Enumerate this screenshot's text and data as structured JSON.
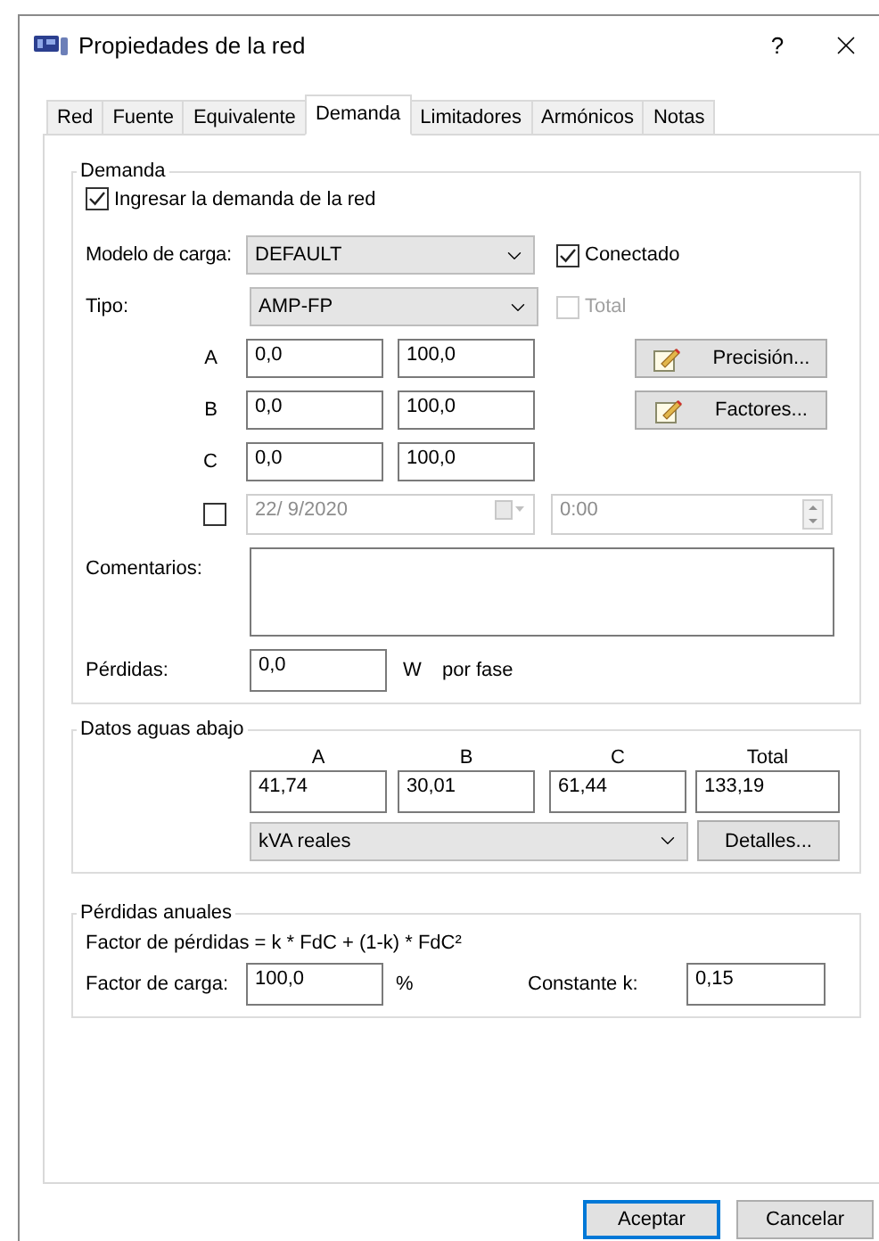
{
  "window": {
    "title": "Propiedades de la red",
    "help": "?"
  },
  "tabs": [
    {
      "label": "Red",
      "selected": false
    },
    {
      "label": "Fuente",
      "selected": false
    },
    {
      "label": "Equivalente",
      "selected": false
    },
    {
      "label": "Demanda",
      "selected": true
    },
    {
      "label": "Limitadores",
      "selected": false
    },
    {
      "label": "Armónicos",
      "selected": false
    },
    {
      "label": "Notas",
      "selected": false
    }
  ],
  "demanda": {
    "title": "Demanda",
    "enter_demand": {
      "label": "Ingresar la demanda de la red",
      "checked": true
    },
    "load_model": {
      "label": "Modelo de carga:",
      "value": "DEFAULT"
    },
    "connected": {
      "label": "Conectado",
      "checked": true,
      "disabled": false
    },
    "type": {
      "label": "Tipo:",
      "value": "AMP-FP"
    },
    "total": {
      "label": "Total",
      "checked": false,
      "disabled": true
    },
    "phases": [
      {
        "label": "A",
        "value_1": "0,0",
        "value_2": "100,0"
      },
      {
        "label": "B",
        "value_1": "0,0",
        "value_2": "100,0"
      },
      {
        "label": "C",
        "value_1": "0,0",
        "value_2": "100,0"
      }
    ],
    "side_buttons": [
      "Precisión...",
      "Factores..."
    ],
    "date_enabled": {
      "checked": false
    },
    "date": {
      "value": "22/ 9/2020",
      "disabled": true
    },
    "time": {
      "value": "0:00",
      "disabled": true
    },
    "comments": {
      "label": "Comentarios:"
    },
    "losses": {
      "label": "Pérdidas:",
      "value": "0,0",
      "unit": "W",
      "suffix": "por fase"
    }
  },
  "downstream": {
    "title": "Datos aguas abajo",
    "columns": [
      {
        "header": "A",
        "value": "41,74"
      },
      {
        "header": "B",
        "value": "30,01"
      },
      {
        "header": "C",
        "value": "61,44"
      },
      {
        "header": "Total",
        "value": "133,19"
      }
    ],
    "unit_select": "kVA reales",
    "details_button": "Detalles..."
  },
  "annual_losses": {
    "title": "Pérdidas anuales",
    "formula": "Factor de pérdidas = k * FdC + (1-k) * FdC²",
    "load_factor": {
      "label": "Factor de carga:",
      "value": "100,0",
      "unit": "%"
    },
    "constant_k": {
      "label": "Constante k:",
      "value": "0,15"
    }
  },
  "buttons": [
    {
      "label": "Aceptar",
      "default": true
    },
    {
      "label": "Cancelar",
      "default": false
    }
  ]
}
